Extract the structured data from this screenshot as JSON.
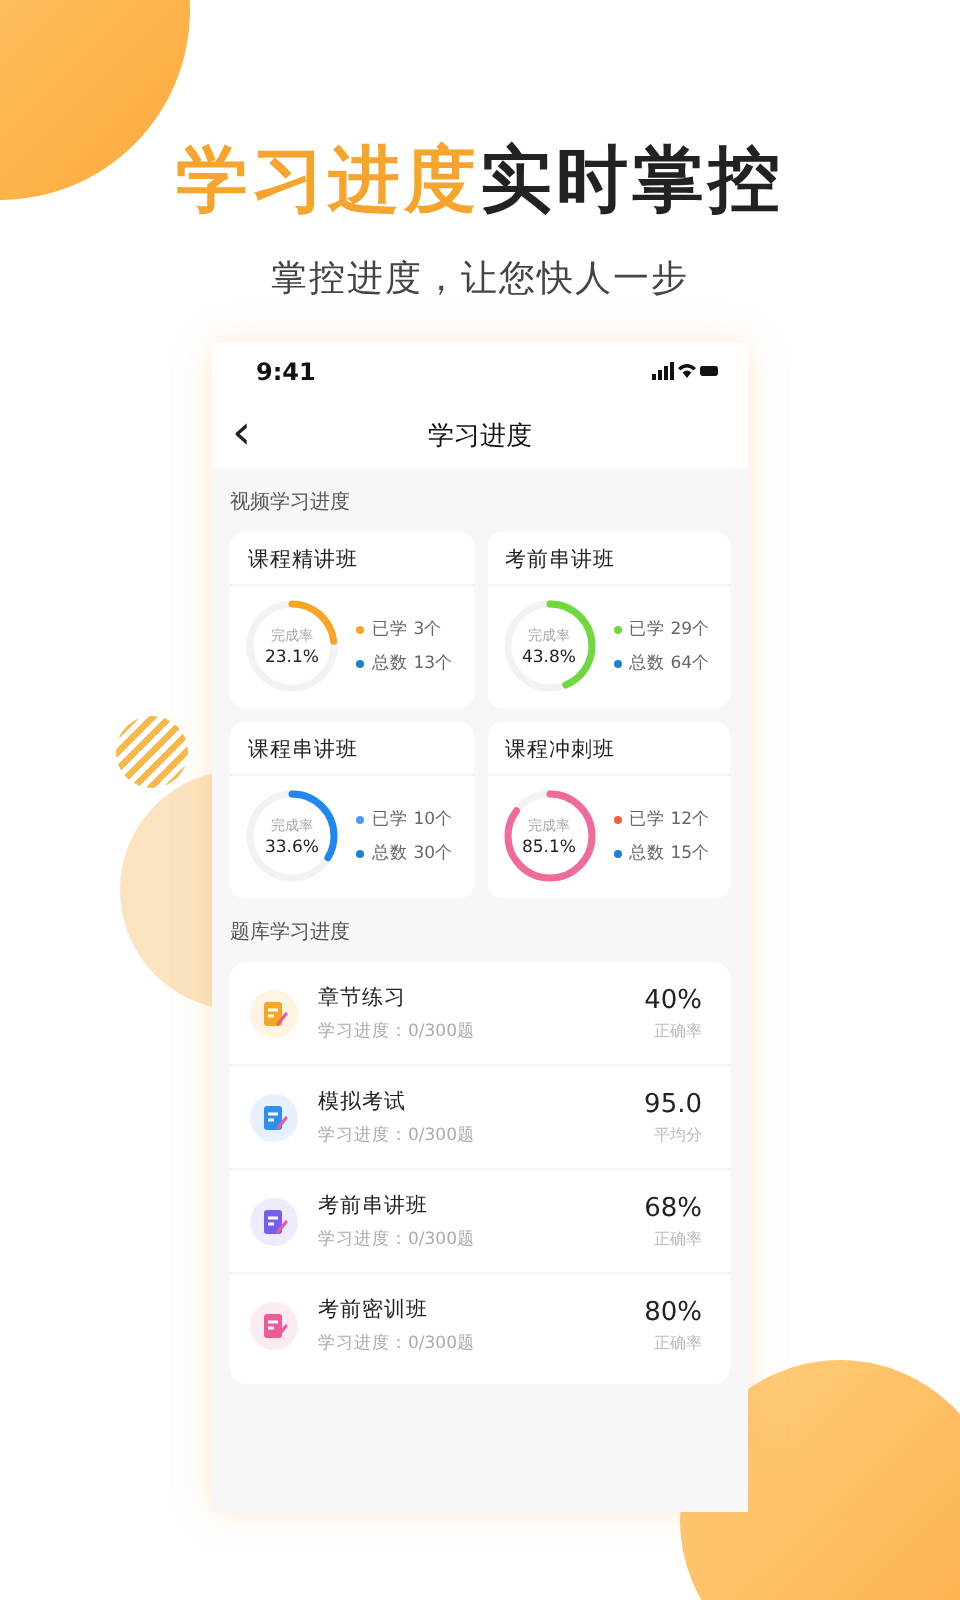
{
  "headline": {
    "accent": "学习进度",
    "rest": "实时掌控"
  },
  "subtitle": "掌控进度，让您快人一步",
  "status_bar": {
    "time": "9:41"
  },
  "nav": {
    "back": "‹",
    "title": "学习进度"
  },
  "video_section": {
    "title": "视频学习进度",
    "cards": [
      {
        "title": "课程精讲班",
        "ring_label": "完成率",
        "percent": "23.1%",
        "level": 0.231,
        "color": "#f5a623",
        "learned": {
          "text": "已学 3个",
          "color": "#f5a623"
        },
        "total": "总数 13个"
      },
      {
        "title": "考前串讲班",
        "ring_label": "完成率",
        "percent": "43.8%",
        "level": 0.438,
        "color": "#6fd83c",
        "learned": {
          "text": "已学 29个",
          "color": "#6fd83c"
        },
        "total": "总数 64个"
      },
      {
        "title": "课程串讲班",
        "ring_label": "完成率",
        "percent": "33.6%",
        "level": 0.336,
        "color": "#1e88f0",
        "learned": {
          "text": "已学 10个",
          "color": "#4a9df5"
        },
        "total": "总数 30个"
      },
      {
        "title": "课程冲刺班",
        "ring_label": "完成率",
        "percent": "85.1%",
        "level": 0.851,
        "color": "#f06a9c",
        "learned": {
          "text": "已学 12个",
          "color": "#f0603c"
        },
        "total": "总数 15个"
      }
    ]
  },
  "bank_section": {
    "title": "题库学习进度",
    "items": [
      {
        "title": "章节练习",
        "progress": "学习进度：0/300题",
        "score": "40%",
        "score_label": "正确率",
        "color": "#f5a623"
      },
      {
        "title": "模拟考试",
        "progress": "学习进度：0/300题",
        "score": "95.0",
        "score_label": "平均分",
        "color": "#2f8ff0"
      },
      {
        "title": "考前串讲班",
        "progress": "学习进度：0/300题",
        "score": "68%",
        "score_label": "正确率",
        "color": "#7b5cf0"
      },
      {
        "title": "考前密训班",
        "progress": "学习进度：0/300题",
        "score": "80%",
        "score_label": "正确率",
        "color": "#ee5c98"
      }
    ]
  }
}
